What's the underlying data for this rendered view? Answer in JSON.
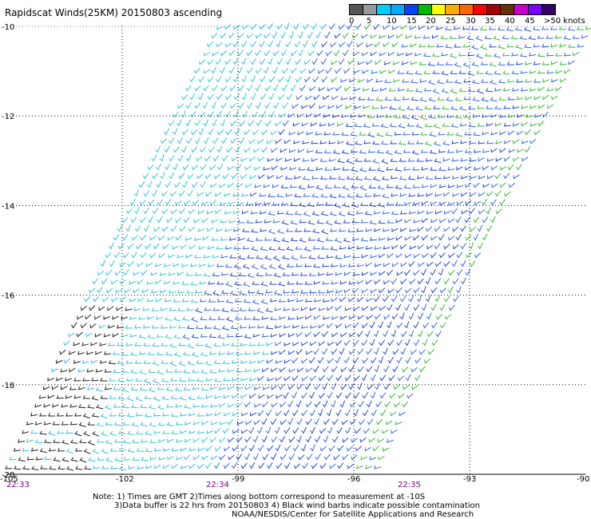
{
  "title": "Rapidscat Winds(25KM) 20150803 ascending",
  "scale": {
    "colors": [
      "#555555",
      "#999999",
      "#00ccff",
      "#00aaff",
      "#0044ff",
      "#00bb00",
      "#ffff00",
      "#ffaa00",
      "#ff6600",
      "#ff0000",
      "#aa0000",
      "#663300",
      "#cc00cc",
      "#7700ff",
      "#330066"
    ],
    "labels": [
      "0",
      "5",
      "10",
      "15",
      "20",
      "25",
      "30",
      "35",
      "40",
      "45",
      ">50 knots"
    ]
  },
  "lat_labels": [
    "-10",
    "-12",
    "-14",
    "-16",
    "-18",
    "-20"
  ],
  "lon_labels": [
    "-105",
    "-102",
    "-99",
    "-96",
    "-93",
    "-90"
  ],
  "time_labels": [
    "22:33",
    "22:34",
    "22:35"
  ],
  "notes": {
    "line1": "Note: 1) Times are GMT 2)Times along bottom correspond to measurement at -10S",
    "line2": "3)Data buffer is 22 hrs from 20150803 4) Black wind barbs indicate possible contamination",
    "line3": "NOAA/NESDIS/Center for Satellite Applications and Research"
  }
}
